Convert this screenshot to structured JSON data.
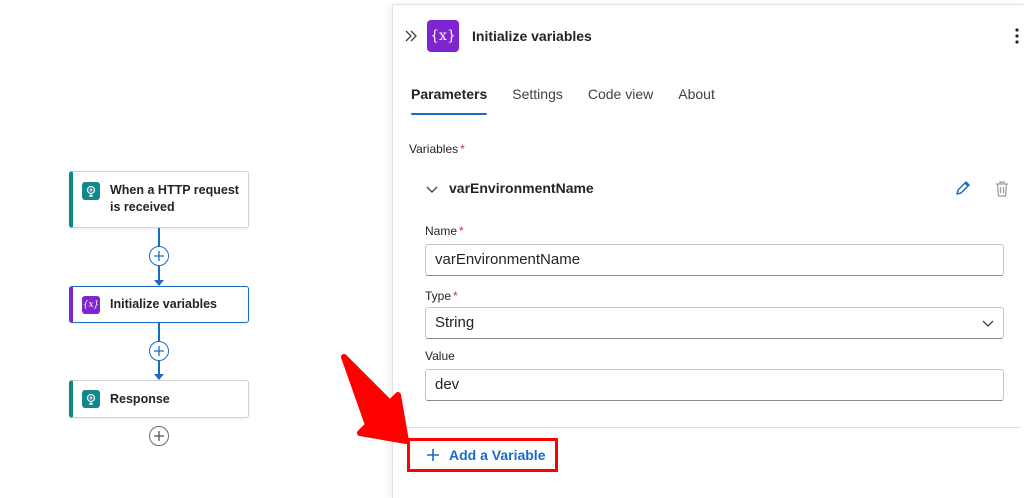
{
  "canvas": {
    "trigger_label": "When a HTTP request is received",
    "init_label": "Initialize variables",
    "response_label": "Response"
  },
  "panel": {
    "title": "Initialize variables",
    "header_icon_text": "{x}",
    "tabs": [
      {
        "label": "Parameters",
        "active": true
      },
      {
        "label": "Settings",
        "active": false
      },
      {
        "label": "Code view",
        "active": false
      },
      {
        "label": "About",
        "active": false
      }
    ],
    "variables_label": "Variables",
    "required_mark": "*",
    "variable": {
      "header": "varEnvironmentName",
      "name_label": "Name",
      "name_value": "varEnvironmentName",
      "type_label": "Type",
      "type_value": "String",
      "value_label": "Value",
      "value_value": "dev"
    },
    "add_variable_label": "Add a Variable"
  },
  "colors": {
    "accent_blue": "#1a6bc7",
    "variable_purple": "#7f24d1",
    "trigger_teal": "#13878e",
    "highlight_red": "#ff0000",
    "required_red": "#c4314b"
  }
}
